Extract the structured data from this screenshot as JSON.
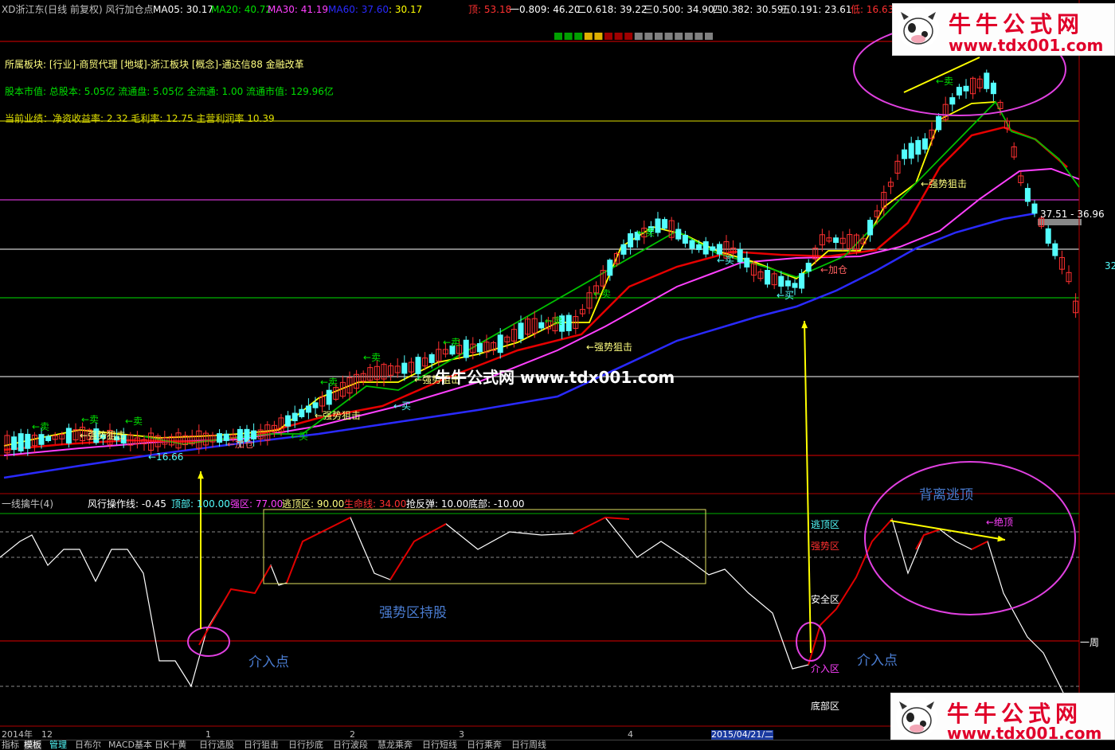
{
  "title_bar": {
    "stock": "XD浙江东(日线 前复权) 风行加仓点",
    "ma5": "MA05: 30.17",
    "ma20": "MA20: 40.72",
    "ma30": "MA30: 41.19",
    "ma60": "MA60: 37.60",
    "extra": ": 30.17",
    "top_val": "顶: 53.18",
    "fib1": "一0.809: 46.20",
    "fib2": "二0.618: 39.22",
    "fib3": "三0.500: 34.90",
    "fib4": "四0.382: 30.59",
    "fib5": "五0.191: 23.61",
    "low_val": "低: 16.63"
  },
  "info": {
    "sector": "所属板块: [行业]-商贸代理 [地域]-浙江板块 [概念]-通达信88 金融改革",
    "capital": "股本市值: 总股本: 5.05亿 流通盘: 5.05亿 全流通: 1.00 流通市值: 129.96亿",
    "performance": "当前业绩：净资收益率: 2.32 毛利率: 12.75 主营利润率 10.39"
  },
  "price_labels": {
    "sell": "←卖",
    "buy": "←买",
    "strong": "←强势狙击",
    "add": "←加仓",
    "low_mark": "←16.66",
    "right_range": "37.51 - 36.96",
    "right_edge": "32"
  },
  "indicator_bar": {
    "name": "一线擒牛(4)",
    "op_line": "风行操作线: -0.45",
    "top": "顶部: 100.00",
    "strong": "强区: 77.00",
    "escape": "逃顶区: 90.00",
    "life": "生命线: 34.00",
    "rebound": "抢反弹: 10.00",
    "bottom": "底部: -10.00"
  },
  "zone_labels": {
    "escape": "逃顶区",
    "strong": "强势区",
    "safe": "安全区",
    "entry": "介入区",
    "bottom": "底部区",
    "week": "一周",
    "abs_top": "←绝顶"
  },
  "annotations": {
    "hold": "强势区持股",
    "entry1": "介入点",
    "entry2": "介入点",
    "divergence": "背离逃顶"
  },
  "watermark": "牛牛公式网  www.tdx001.com",
  "logo": {
    "name": "牛牛公式网",
    "url": "www.tdx001.com"
  },
  "date_axis": {
    "year": "2014年",
    "m12": "12",
    "m1": "1",
    "m2": "2",
    "m3": "3",
    "m4": "4",
    "cursor_date": "2015/04/21/二"
  },
  "tabs": [
    "指标",
    "模板",
    "管理",
    "日布尔",
    "MACD基本",
    "日K十黄",
    "日行选股",
    "日行狙击",
    "日行抄底",
    "日行波段",
    "慧龙乘奔",
    "日行短线",
    "日行乘奔",
    "日行周线"
  ],
  "colors": {
    "ma5": "#ffff00",
    "ma20": "#e60000",
    "ma30": "#ff40ff",
    "ma60": "#2a2aff",
    "ma_green": "#00c000",
    "up_candle": "#ff3030",
    "down_candle": "#54ffff",
    "signal": "#ffff00"
  }
}
